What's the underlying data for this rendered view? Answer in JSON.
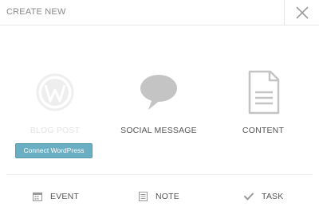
{
  "dialog": {
    "title": "CREATE NEW",
    "close_icon": "close-icon"
  },
  "options": {
    "blog_post": {
      "label": "BLOG POST",
      "icon": "wordpress-icon",
      "disabled": true
    },
    "social_message": {
      "label": "SOCIAL MESSAGE",
      "icon": "speech-bubble-icon"
    },
    "content": {
      "label": "CONTENT",
      "icon": "document-icon"
    }
  },
  "connect_button": {
    "label": "Connect WordPress"
  },
  "bottom": {
    "event": {
      "label": "EVENT",
      "icon": "calendar-icon"
    },
    "note": {
      "label": "NOTE",
      "icon": "note-icon"
    },
    "task": {
      "label": "TASK",
      "icon": "checkmark-icon"
    }
  },
  "colors": {
    "accent": "#6aaec3",
    "icon": "#c4c4c4",
    "disabled": "#eeeeee",
    "text": "#555555"
  }
}
